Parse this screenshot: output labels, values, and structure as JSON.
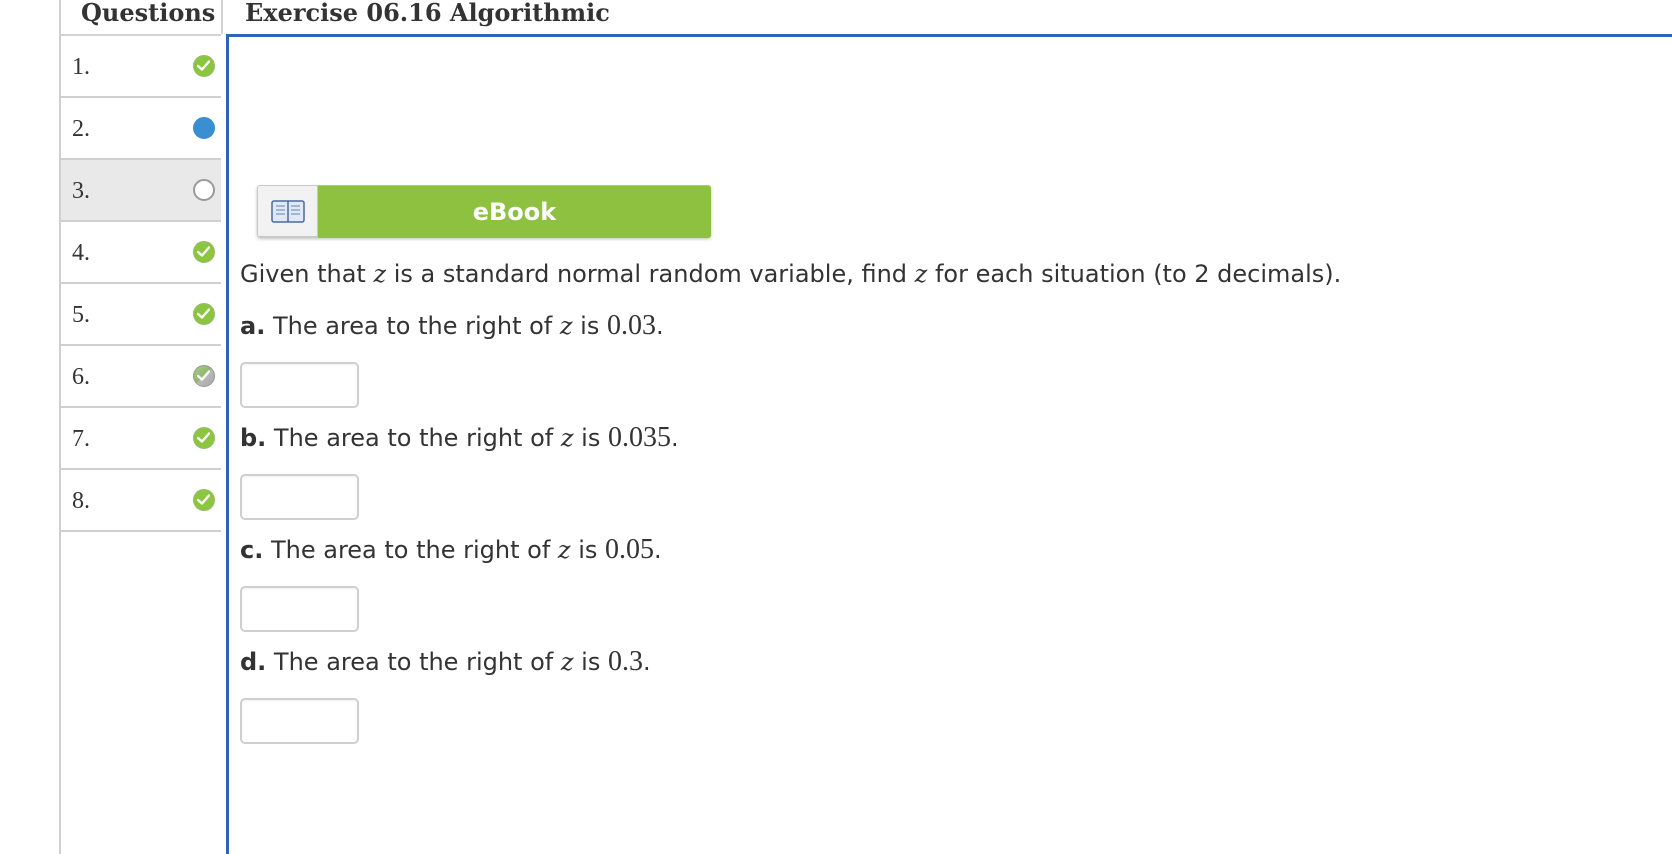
{
  "sidebar": {
    "header": "Questions",
    "items": [
      {
        "number": "1.",
        "status": "check-icon"
      },
      {
        "number": "2.",
        "status": "current-dot-icon"
      },
      {
        "number": "3.",
        "status": "empty-circle-icon"
      },
      {
        "number": "4.",
        "status": "check-icon"
      },
      {
        "number": "5.",
        "status": "check-icon"
      },
      {
        "number": "6.",
        "status": "partial-check-icon"
      },
      {
        "number": "7.",
        "status": "check-icon"
      },
      {
        "number": "8.",
        "status": "check-icon"
      }
    ]
  },
  "main": {
    "title": "Exercise 06.16 Algorithmic",
    "ebook_label": "eBook",
    "prompt": {
      "before": "Given that ",
      "var1": "z",
      "middle": " is a standard normal random variable, find ",
      "var2": "z",
      "after": " for each situation (to 2 decimals)."
    },
    "parts": [
      {
        "letter": "a.",
        "text": " The area to the right of ",
        "var": "z",
        "is": " is ",
        "value": "0.03",
        "end": "."
      },
      {
        "letter": "b.",
        "text": " The area to the right of ",
        "var": "z",
        "is": " is ",
        "value": "0.035",
        "end": "."
      },
      {
        "letter": "c.",
        "text": " The area to the right of ",
        "var": "z",
        "is": " is ",
        "value": "0.05",
        "end": "."
      },
      {
        "letter": "d.",
        "text": " The area to the right of ",
        "var": "z",
        "is": " is ",
        "value": "0.3",
        "end": "."
      }
    ]
  },
  "colors": {
    "accent_border": "#2e65b8",
    "ebook_green": "#8dc13f",
    "check_green": "#8cc63e",
    "current_blue": "#3a8fd3"
  }
}
